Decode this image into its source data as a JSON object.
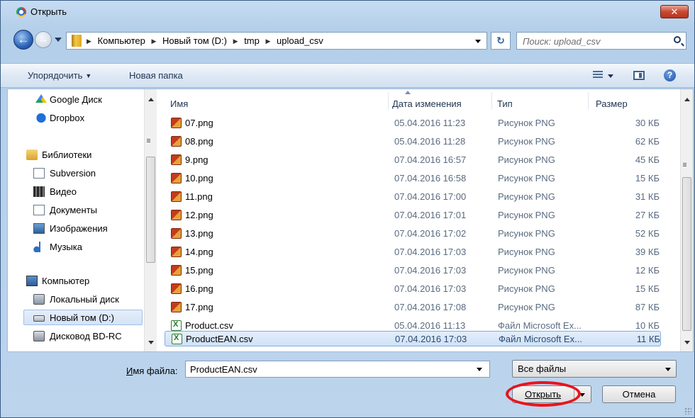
{
  "window": {
    "title": "Открыть"
  },
  "address": {
    "crumbs": [
      "Компьютер",
      "Новый том (D:)",
      "tmp",
      "upload_csv"
    ],
    "search_placeholder": "Поиск: upload_csv"
  },
  "toolbar": {
    "organize": "Упорядочить",
    "new_folder": "Новая папка"
  },
  "nav": {
    "items": [
      {
        "label": "Google Диск",
        "icon": "google-drive-icon"
      },
      {
        "label": "Dropbox",
        "icon": "dropbox-icon"
      },
      {
        "label": "Библиотеки",
        "icon": "libraries-icon"
      },
      {
        "label": "Subversion",
        "icon": "subversion-icon"
      },
      {
        "label": "Видео",
        "icon": "video-icon"
      },
      {
        "label": "Документы",
        "icon": "documents-icon"
      },
      {
        "label": "Изображения",
        "icon": "images-icon"
      },
      {
        "label": "Музыка",
        "icon": "music-icon"
      },
      {
        "label": "Компьютер",
        "icon": "computer-icon"
      },
      {
        "label": "Локальный диск",
        "icon": "local-disk-icon"
      },
      {
        "label": "Новый том (D:)",
        "icon": "drive-icon",
        "selected": true
      },
      {
        "label": "Дисковод BD-RC",
        "icon": "bd-drive-icon"
      }
    ]
  },
  "columns": {
    "name": "Имя",
    "date": "Дата изменения",
    "type": "Тип",
    "size": "Размер"
  },
  "files": [
    {
      "name": "07.png",
      "date": "05.04.2016 11:23",
      "type": "Рисунок PNG",
      "size": "30 КБ",
      "kind": "png"
    },
    {
      "name": "08.png",
      "date": "05.04.2016 11:28",
      "type": "Рисунок PNG",
      "size": "62 КБ",
      "kind": "png"
    },
    {
      "name": "9.png",
      "date": "07.04.2016 16:57",
      "type": "Рисунок PNG",
      "size": "45 КБ",
      "kind": "png"
    },
    {
      "name": "10.png",
      "date": "07.04.2016 16:58",
      "type": "Рисунок PNG",
      "size": "15 КБ",
      "kind": "png"
    },
    {
      "name": "11.png",
      "date": "07.04.2016 17:00",
      "type": "Рисунок PNG",
      "size": "31 КБ",
      "kind": "png"
    },
    {
      "name": "12.png",
      "date": "07.04.2016 17:01",
      "type": "Рисунок PNG",
      "size": "27 КБ",
      "kind": "png"
    },
    {
      "name": "13.png",
      "date": "07.04.2016 17:02",
      "type": "Рисунок PNG",
      "size": "52 КБ",
      "kind": "png"
    },
    {
      "name": "14.png",
      "date": "07.04.2016 17:03",
      "type": "Рисунок PNG",
      "size": "39 КБ",
      "kind": "png"
    },
    {
      "name": "15.png",
      "date": "07.04.2016 17:03",
      "type": "Рисунок PNG",
      "size": "12 КБ",
      "kind": "png"
    },
    {
      "name": "16.png",
      "date": "07.04.2016 17:03",
      "type": "Рисунок PNG",
      "size": "15 КБ",
      "kind": "png"
    },
    {
      "name": "17.png",
      "date": "07.04.2016 17:08",
      "type": "Рисунок PNG",
      "size": "87 КБ",
      "kind": "png"
    },
    {
      "name": "Product.csv",
      "date": "05.04.2016 11:13",
      "type": "Файл Microsoft Ex...",
      "size": "10 КБ",
      "kind": "csv"
    },
    {
      "name": "ProductEAN.csv",
      "date": "07.04.2016 17:03",
      "type": "Файл Microsoft Ex...",
      "size": "11 КБ",
      "kind": "csv",
      "selected": true
    }
  ],
  "bottom": {
    "filename_label_underlined": "И",
    "filename_label_rest": "мя файла:",
    "filename_value": "ProductEAN.csv",
    "filter": "Все файлы",
    "open_button": "Открыть",
    "cancel_button": "Отмена"
  },
  "colors": {
    "selection": "#cfe2f8",
    "highlight_oval": "#e8141c",
    "title_close": "#c74a33"
  }
}
